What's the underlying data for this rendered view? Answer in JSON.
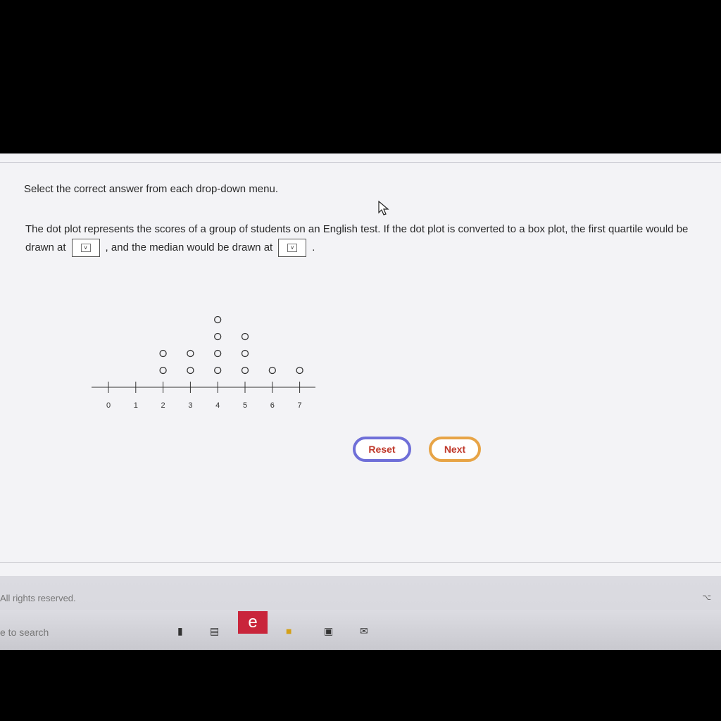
{
  "instruction": "Select the correct answer from each drop-down menu.",
  "question": {
    "part1": "The dot plot represents the scores of a group of students on an English test. If the dot plot is converted to a box plot, the first quartile would be",
    "part2": "drawn at",
    "part3": ", and the median would be drawn at",
    "part4": "."
  },
  "dropdowns": [
    {
      "selected": ""
    },
    {
      "selected": ""
    }
  ],
  "chart_data": {
    "type": "scatter",
    "x_ticks": [
      "0",
      "1",
      "2",
      "3",
      "4",
      "5",
      "6",
      "7"
    ],
    "dot_counts": [
      {
        "x": 2,
        "count": 2
      },
      {
        "x": 3,
        "count": 2
      },
      {
        "x": 4,
        "count": 4
      },
      {
        "x": 5,
        "count": 3
      },
      {
        "x": 6,
        "count": 1
      },
      {
        "x": 7,
        "count": 1
      }
    ],
    "xlim": [
      0,
      7
    ]
  },
  "buttons": {
    "reset": "Reset",
    "next": "Next"
  },
  "footer": {
    "rights": "All rights reserved."
  },
  "taskbar": {
    "search_text": "e to search"
  }
}
